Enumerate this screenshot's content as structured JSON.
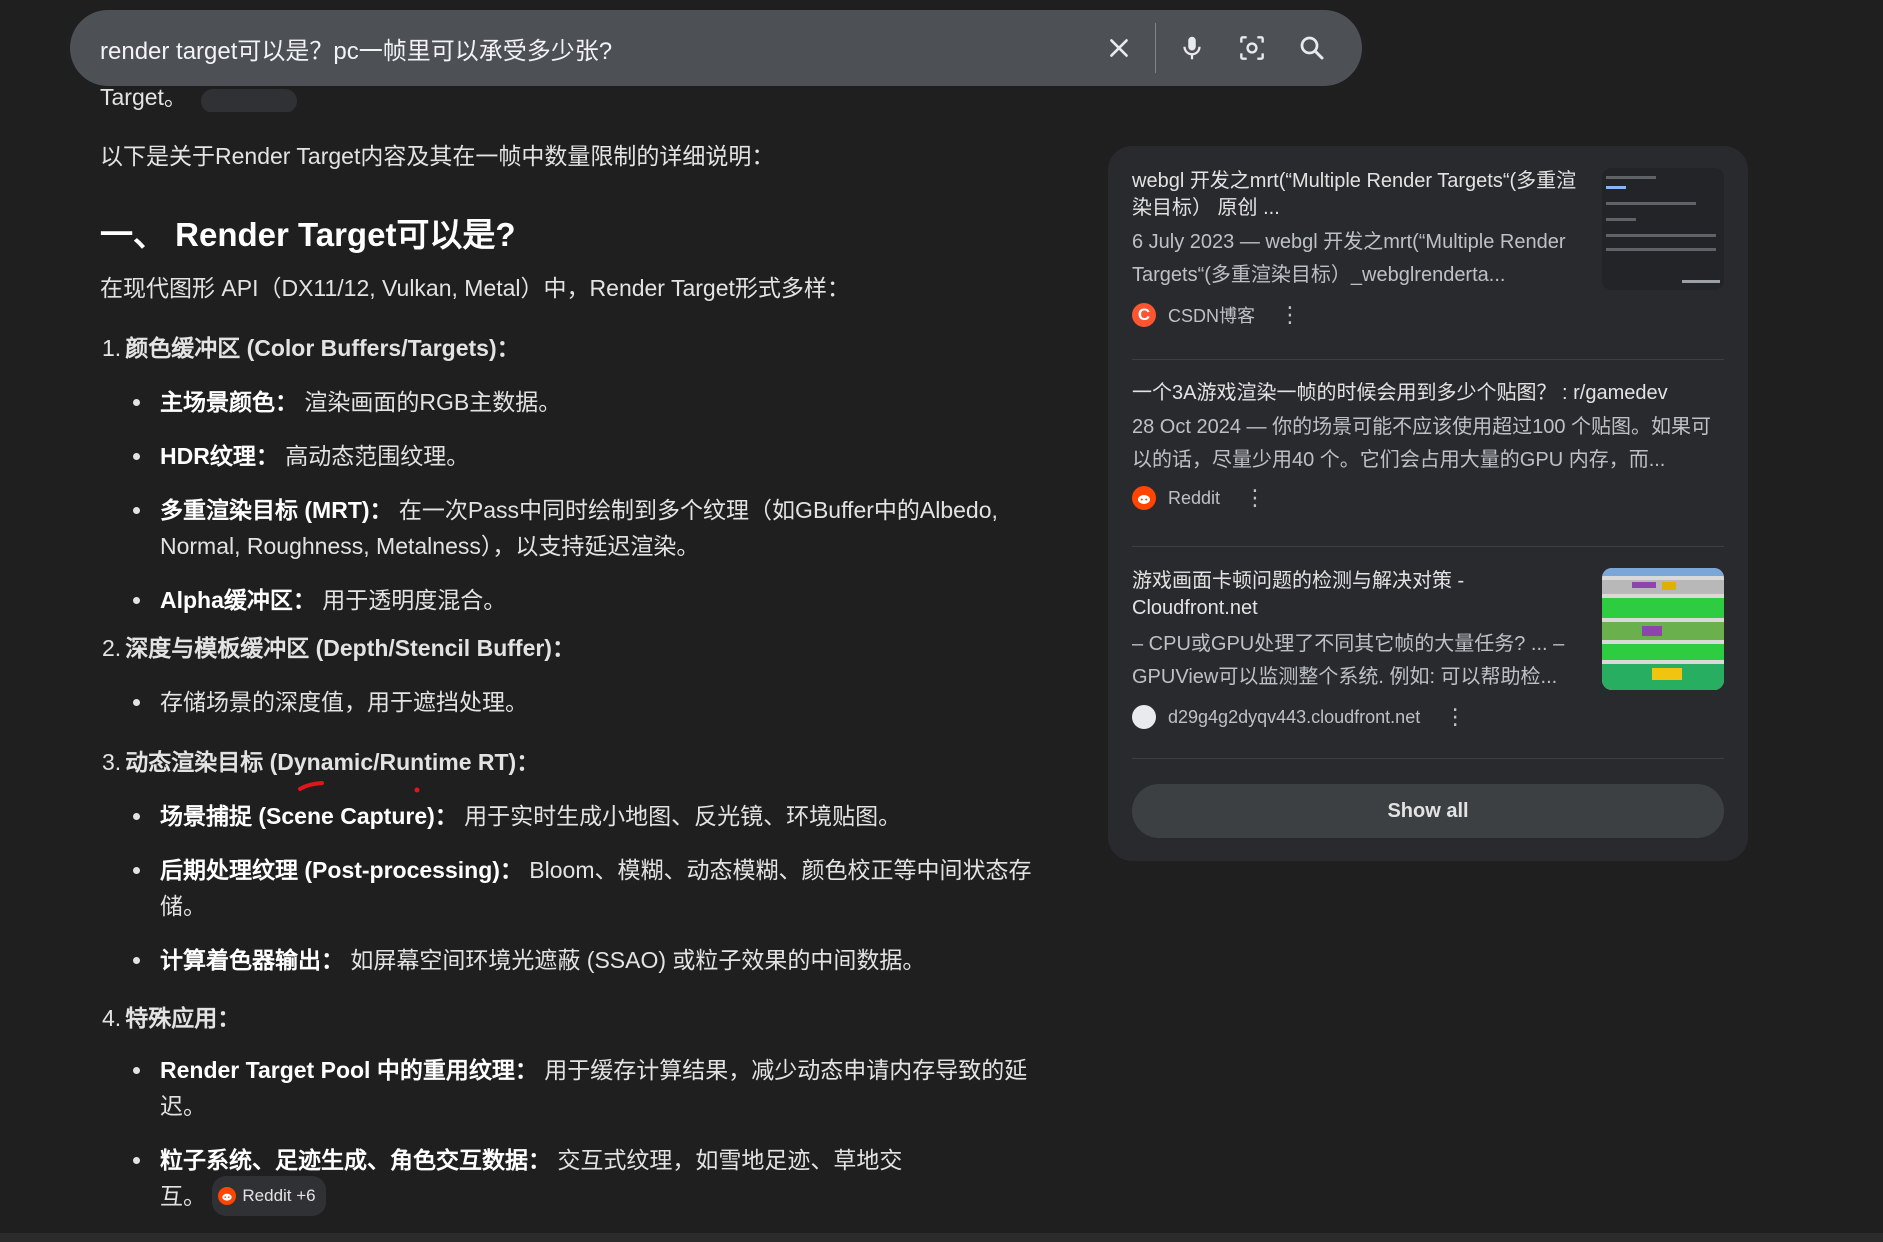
{
  "search": {
    "query": "render target可以是？pc一帧里可以承受多少张?"
  },
  "main": {
    "partial_text": "Target。",
    "intro": "以下是关于Render Target内容及其在一帧中数量限制的详细说明：",
    "heading": "一、 Render Target可以是?",
    "lead": "在现代图形 API（DX11/12, Vulkan, Metal）中，Render Target形式多样：",
    "sections": [
      {
        "num": "1.",
        "title": "颜色缓冲区 (Color Buffers/Targets)：",
        "bullets": [
          {
            "bold": "主场景颜色：",
            "text": " 渲染画面的RGB主数据。"
          },
          {
            "bold": "HDR纹理：",
            "text": " 高动态范围纹理。"
          },
          {
            "bold": "多重渲染目标 (MRT)：",
            "text": " 在一次Pass中同时绘制到多个纹理（如GBuffer中的Albedo, Normal, Roughness, Metalness），以支持延迟渲染。"
          },
          {
            "bold": "Alpha缓冲区：",
            "text": " 用于透明度混合。"
          }
        ]
      },
      {
        "num": "2.",
        "title": "深度与模板缓冲区 (Depth/Stencil Buffer)：",
        "bullets": [
          {
            "bold": "",
            "text": "存储场景的深度值，用于遮挡处理。"
          }
        ]
      },
      {
        "num": "3.",
        "title": "动态渲染目标 (Dynamic/Runtime RT)：",
        "bullets": [
          {
            "bold": "场景捕捉 (Scene Capture)：",
            "text": " 用于实时生成小地图、反光镜、环境贴图。"
          },
          {
            "bold": "后期处理纹理 (Post-processing)：",
            "text": " Bloom、模糊、动态模糊、颜色校正等中间状态存储。"
          },
          {
            "bold": "计算着色器输出：",
            "text": " 如屏幕空间环境光遮蔽 (SSAO) 或粒子效果的中间数据。"
          }
        ]
      },
      {
        "num": "4.",
        "title": "特殊应用：",
        "bullets": [
          {
            "bold": "Render Target Pool 中的重用纹理：",
            "text": " 用于缓存计算结果，减少动态申请内存导致的延迟。"
          },
          {
            "bold": "粒子系统、足迹生成、角色交互数据：",
            "text": " 交互式纹理，如雪地足迹、草地交互。"
          }
        ]
      }
    ],
    "source_chip": "Reddit +6"
  },
  "sidebar": {
    "results": [
      {
        "title": "webgl 开发之mrt(“Multiple Render Targets“(多重渲染目标） 原创 ...",
        "snippet": "6 July 2023 — webgl 开发之mrt(“Multiple Render Targets“(多重渲染目标）_webglrenderta...",
        "source": "CSDN博客",
        "favicon_letter": "C",
        "favicon_color": "#fc5531"
      },
      {
        "title": "一个3A游戏渲染一帧的时候会用到多少个贴图？ : r/gamedev",
        "snippet": "28 Oct 2024 — 你的场景可能不应该使用超过100 个贴图。如果可以的话，尽量少用40 个。它们会占用大量的GPU 内存，而...",
        "source": "Reddit",
        "favicon_color": "#ff4500"
      },
      {
        "title": "游戏画面卡顿问题的检测与解决对策 - Cloudfront.net",
        "snippet": "– CPU或GPU处理了不同其它帧的大量任务? ... – GPUView可以监测整个系统. 例如: 可以帮助检...",
        "source": "d29g4g2dyqv443.cloudfront.net",
        "favicon_color": "#e8eaed"
      }
    ],
    "show_all": "Show all"
  }
}
